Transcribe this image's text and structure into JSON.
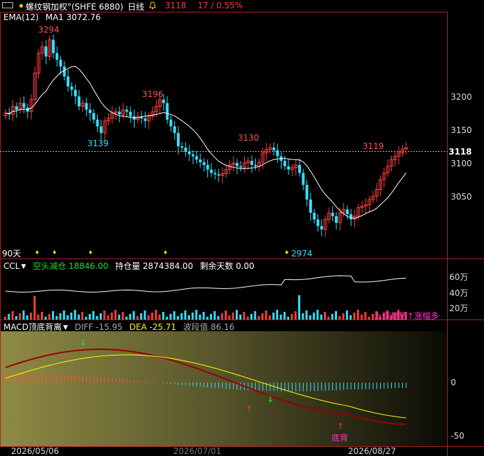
{
  "header": {
    "window_icon": "window-toggle-icon",
    "bullet_icon": "yellow-dot-icon",
    "symbol_name": "螺纹钢加权°(SHFE 6880)",
    "period": "日线",
    "bell_icon": "bell-icon",
    "last_price": "3118",
    "change": "17 / 0.55%"
  },
  "main_panel": {
    "ema_label": "EMA(12)",
    "ma_label": "MA1 3072.76",
    "y_ticks": [
      "3200",
      "3150",
      "3100",
      "3050"
    ],
    "price_tag": "3118",
    "annotations": {
      "high_left": "3294",
      "low_left": "3139",
      "mid_high": "3196",
      "right_high": "3130",
      "recent_high": "3119",
      "low_right": "2974"
    },
    "days_label": "90天",
    "colors": {
      "up": "#ff3b3b",
      "down": "#33e0ff",
      "ma": "#ffffff"
    }
  },
  "ccl_panel": {
    "name": "CCL",
    "signal": "空头减仓 18846.00",
    "open_interest": "持仓量 2874384.00",
    "days_left": "剩余天数 0.00",
    "y_ticks": [
      "60万",
      "40万",
      "20万"
    ],
    "trend_text": "上涨趋势↑涨幅多"
  },
  "macd_panel": {
    "name": "MACD顶底背离",
    "diff": "DIFF -15.95",
    "dea": "DEA -25.71",
    "wave": "波段值 86.16",
    "y_ticks": [
      "0",
      "-50"
    ],
    "bottom_label": "底背"
  },
  "x_axis": {
    "dates": [
      "2026/05/06",
      "2026/07/01",
      "2026/08/27"
    ]
  },
  "chart_data": {
    "type": "candlestick",
    "ylim": [
      2974,
      3294
    ],
    "annotated_points": [
      {
        "label": "3294",
        "value": 3294
      },
      {
        "label": "3139",
        "value": 3139
      },
      {
        "label": "3196",
        "value": 3196
      },
      {
        "label": "3130",
        "value": 3130
      },
      {
        "label": "2974",
        "value": 2974
      },
      {
        "label": "3119",
        "value": 3119
      }
    ],
    "closes": [
      3170,
      3168,
      3180,
      3175,
      3185,
      3178,
      3172,
      3190,
      3230,
      3260,
      3270,
      3255,
      3280,
      3260,
      3250,
      3240,
      3225,
      3210,
      3205,
      3195,
      3180,
      3185,
      3175,
      3170,
      3160,
      3150,
      3140,
      3158,
      3162,
      3170,
      3172,
      3168,
      3175,
      3172,
      3165,
      3160,
      3165,
      3162,
      3158,
      3165,
      3172,
      3180,
      3190,
      3185,
      3160,
      3150,
      3140,
      3120,
      3118,
      3112,
      3108,
      3105,
      3100,
      3096,
      3092,
      3085,
      3080,
      3078,
      3076,
      3079,
      3085,
      3092,
      3095,
      3090,
      3088,
      3095,
      3098,
      3092,
      3090,
      3096,
      3110,
      3115,
      3118,
      3114,
      3105,
      3098,
      3090,
      3085,
      3088,
      3092,
      3080,
      3062,
      3040,
      3020,
      3010,
      3000,
      2995,
      3010,
      3020,
      3015,
      3005,
      3020,
      3025,
      3018,
      3010,
      3015,
      3028,
      3030,
      3032,
      3040,
      3045,
      3055,
      3070,
      3080,
      3090,
      3100,
      3105,
      3110,
      3116,
      3118
    ]
  }
}
